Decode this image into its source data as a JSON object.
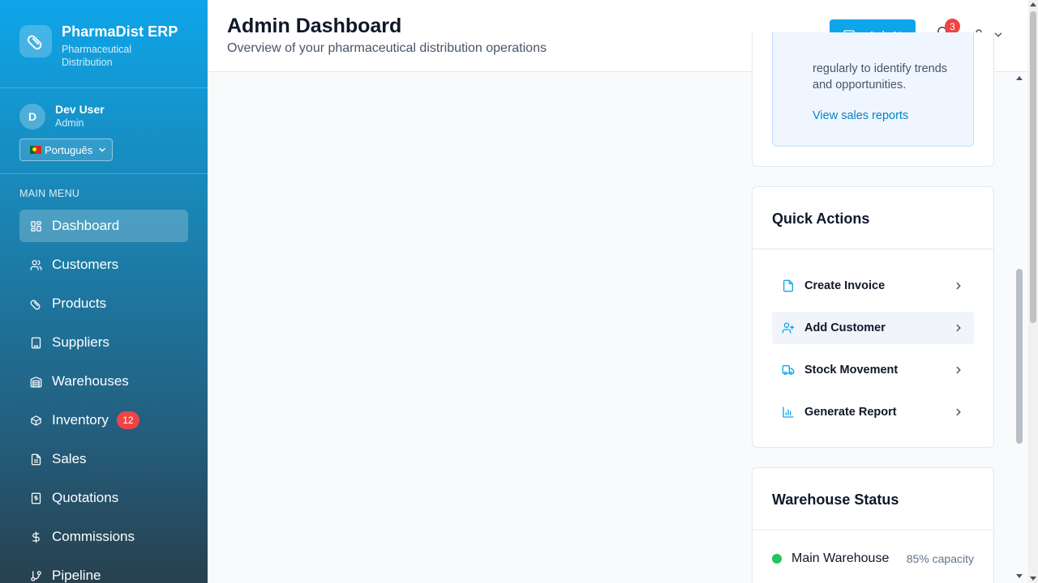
{
  "brand": {
    "name": "PharmaDist ERP",
    "subtitle": "Pharmaceutical Distribution"
  },
  "user": {
    "initial": "D",
    "name": "Dev User",
    "role": "Admin",
    "language": "Português"
  },
  "sidebar": {
    "menu_title": "MAIN MENU",
    "items": [
      {
        "label": "Dashboard",
        "icon": "layout-grid-icon",
        "active": true
      },
      {
        "label": "Customers",
        "icon": "users-icon"
      },
      {
        "label": "Products",
        "icon": "pill-icon"
      },
      {
        "label": "Suppliers",
        "icon": "building-icon"
      },
      {
        "label": "Warehouses",
        "icon": "warehouse-icon"
      },
      {
        "label": "Inventory",
        "icon": "package-icon",
        "badge": "12"
      },
      {
        "label": "Sales",
        "icon": "file-text-icon"
      },
      {
        "label": "Quotations",
        "icon": "receipt-icon"
      },
      {
        "label": "Commissions",
        "icon": "dollar-icon"
      },
      {
        "label": "Pipeline",
        "icon": "git-branch-icon"
      }
    ]
  },
  "header": {
    "title": "Admin Dashboard",
    "subtitle": "Overview of your pharmaceutical distribution operations",
    "ask_ai": "Ask AI",
    "notification_count": "3"
  },
  "tip_card": {
    "text": "regularly to identify trends and opportunities.",
    "link": "View sales reports"
  },
  "quick_actions": {
    "title": "Quick Actions",
    "items": [
      {
        "label": "Create Invoice",
        "icon": "file-icon"
      },
      {
        "label": "Add Customer",
        "icon": "user-plus-icon"
      },
      {
        "label": "Stock Movement",
        "icon": "truck-icon"
      },
      {
        "label": "Generate Report",
        "icon": "bar-chart-icon"
      }
    ]
  },
  "warehouse_status": {
    "title": "Warehouse Status",
    "items": [
      {
        "name": "Main Warehouse",
        "capacity": "85% capacity",
        "status_color": "#22c55e"
      }
    ]
  },
  "colors": {
    "accent": "#0ea5e9",
    "badge": "#ef4444",
    "link": "#0284c7"
  }
}
